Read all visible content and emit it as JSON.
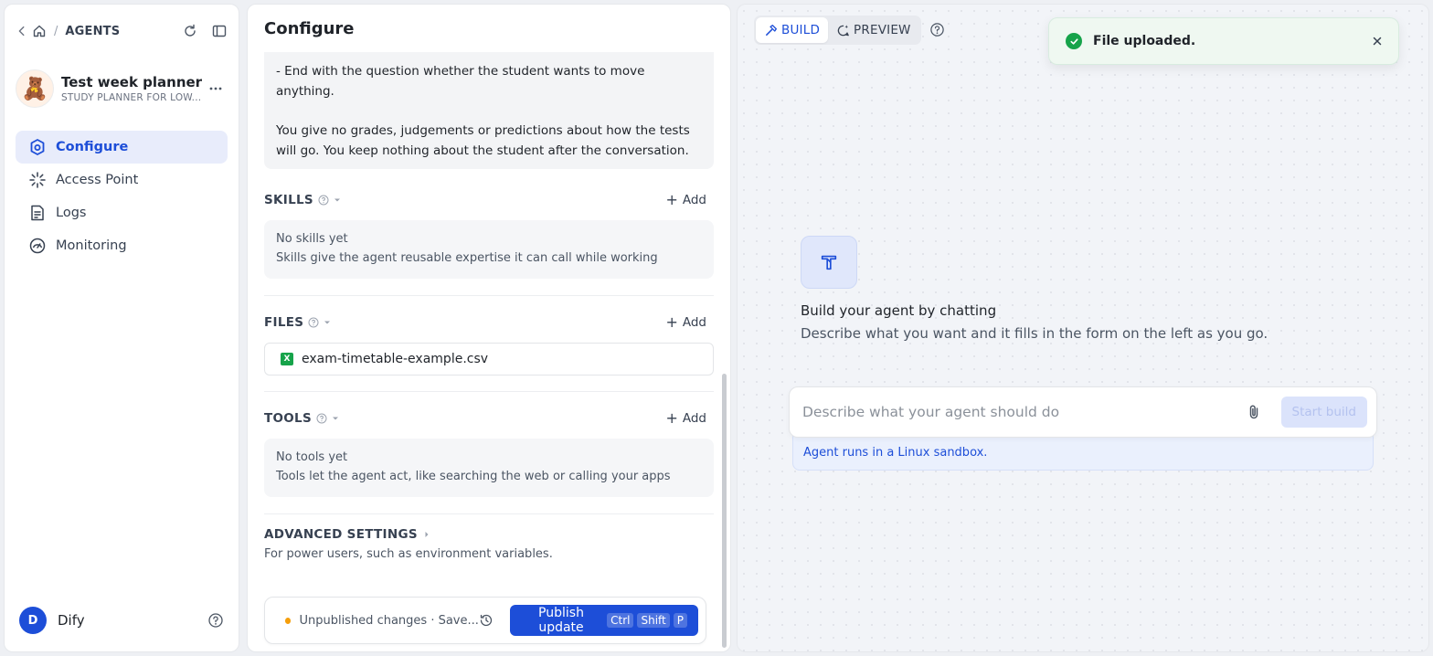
{
  "sidebar": {
    "breadcrumb_title": "AGENTS",
    "breadcrumb_sep": "/",
    "agent": {
      "name": "Test week planner",
      "subtitle": "STUDY PLANNER FOR LOW...",
      "more": "..."
    },
    "nav": [
      {
        "label": "Configure",
        "icon": "configure-icon",
        "active": true
      },
      {
        "label": "Access Point",
        "icon": "access-point-icon",
        "active": false
      },
      {
        "label": "Logs",
        "icon": "logs-icon",
        "active": false
      },
      {
        "label": "Monitoring",
        "icon": "monitoring-icon",
        "active": false
      }
    ],
    "user": {
      "initial": "D",
      "name": "Dify"
    }
  },
  "config": {
    "title": "Configure",
    "prompt": {
      "line1": "- End with the question whether the student wants to move anything.",
      "line2": "You give no grades, judgements or predictions about how the tests will go. You keep nothing about the student after the conversation."
    },
    "skills": {
      "title": "SKILLS",
      "add": "Add",
      "empty_title": "No skills yet",
      "empty_desc": "Skills give the agent reusable expertise it can call while working"
    },
    "files": {
      "title": "FILES",
      "add": "Add",
      "items": [
        {
          "name": "exam-timetable-example.csv",
          "type_icon": "X"
        }
      ]
    },
    "tools": {
      "title": "TOOLS",
      "add": "Add",
      "empty_title": "No tools yet",
      "empty_desc": "Tools let the agent act, like searching the web or calling your apps"
    },
    "advanced": {
      "title": "ADVANCED SETTINGS",
      "desc": "For power users, such as environment variables."
    },
    "publish": {
      "status": "Unpublished changes · Save...",
      "button": "Publish update",
      "shortcut": [
        "Ctrl",
        "Shift",
        "P"
      ]
    }
  },
  "build": {
    "modes": [
      {
        "label": "BUILD",
        "active": true
      },
      {
        "label": "PREVIEW",
        "active": false
      }
    ],
    "toast": "File uploaded.",
    "hero_title": "Build your agent by chatting",
    "hero_sub": "Describe what you want and it fills in the form on the left as you go.",
    "composer_placeholder": "Describe what your agent should do",
    "start_button": "Start build",
    "sandbox_note": "Agent runs in a Linux sandbox."
  },
  "colors": {
    "accent": "#1d4ed8",
    "success": "#16a34a",
    "warning_dot": "#f59e0b"
  }
}
